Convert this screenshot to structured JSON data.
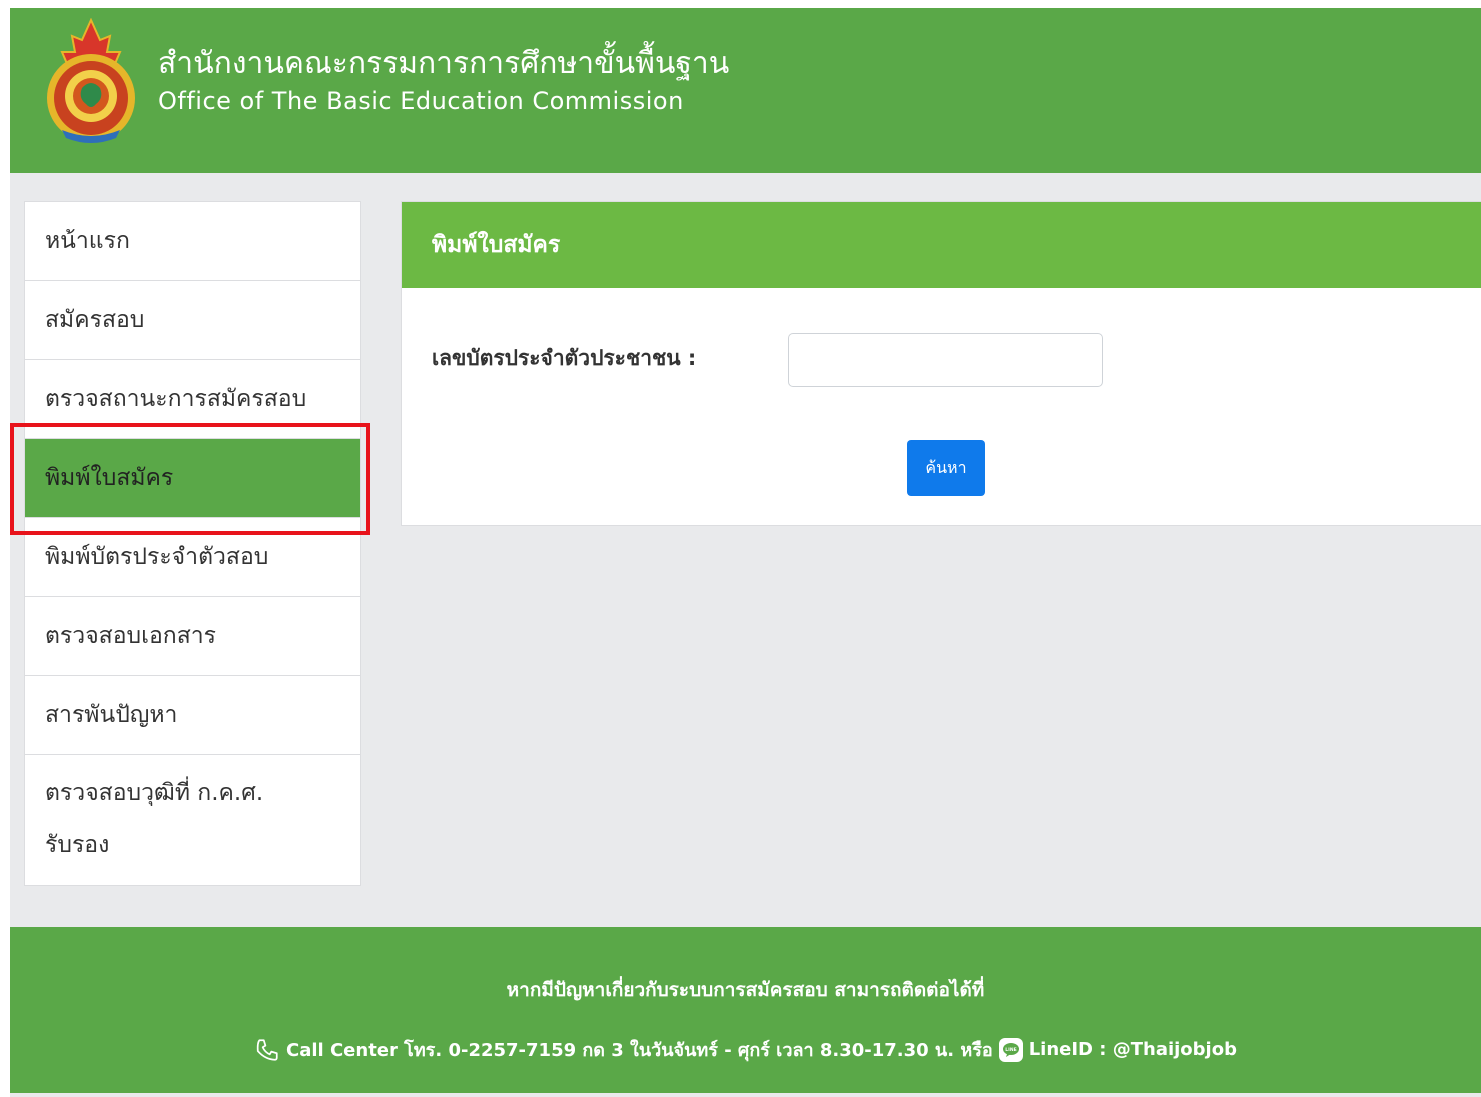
{
  "header": {
    "title_th": "สำนักงานคณะกรรมการการศึกษาขั้นพื้นฐาน",
    "title_en": "Office of The Basic Education Commission",
    "logo_icon": "obec-emblem-icon"
  },
  "sidebar": {
    "items": [
      {
        "label": "หน้าแรก"
      },
      {
        "label": "สมัครสอบ"
      },
      {
        "label": "ตรวจสถานะการสมัครสอบ"
      },
      {
        "label": "พิมพ์ใบสมัคร",
        "active": true
      },
      {
        "label": "พิมพ์บัตรประจำตัวสอบ"
      },
      {
        "label": "ตรวจสอบเอกสาร"
      },
      {
        "label": "สารพันปัญหา"
      },
      {
        "label": "ตรวจสอบวุฒิที่ ก.ค.ศ. รับรอง"
      }
    ]
  },
  "panel": {
    "title": "พิมพ์ใบสมัคร",
    "field_label": "เลขบัตรประจำตัวประชาชน :",
    "field_value": "",
    "field_placeholder": "",
    "search_label": "ค้นหา"
  },
  "footer": {
    "line1": "หากมีปัญหาเกี่ยวกับระบบการสมัครสอบ สามารถติดต่อได้ที่",
    "call_text": "Call Center โทร. 0-2257-7159 กด 3 ในวันจันทร์ - ศุกร์ เวลา 8.30-17.30 น. หรือ",
    "line_text": "LineID : @Thaijobjob",
    "phone_icon": "phone-icon",
    "line_icon": "line-app-icon"
  },
  "colors": {
    "header_green": "#5aa848",
    "panel_header_green": "#6cb944",
    "button_blue": "#0f7aeb",
    "highlight_red": "#e8131b",
    "page_background": "#e9eaec"
  }
}
